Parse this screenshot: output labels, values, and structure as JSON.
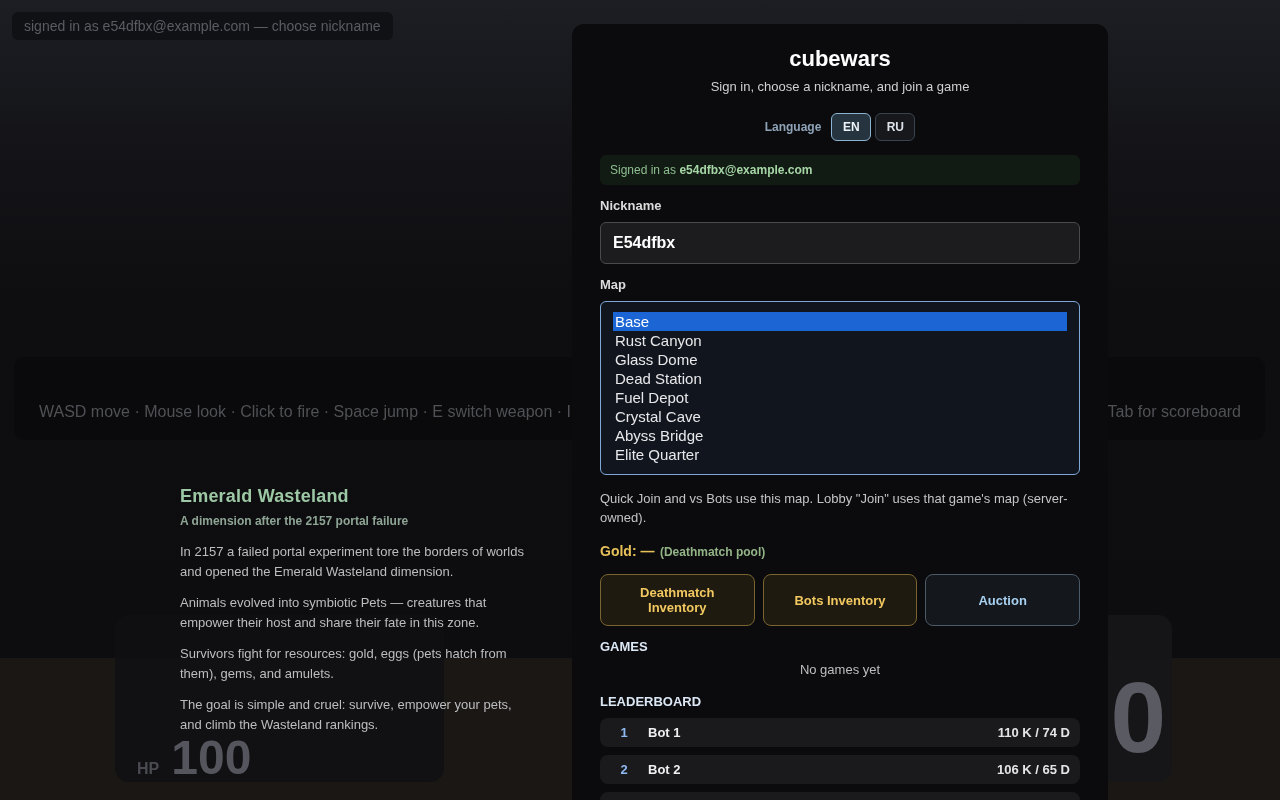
{
  "account_status": {
    "text": "signed in as e54dfbx@example.com — choose nickname"
  },
  "controls_hint": {
    "left_text": "WASD move · Mouse look · Click to fire · Space jump · E switch weapon · I",
    "right_text": "Tab for scoreboard"
  },
  "hud": {
    "hp": {
      "label": "HP",
      "value": "100"
    },
    "armor": {
      "value": "0"
    }
  },
  "lore": {
    "title": "Emerald Wasteland",
    "subtitle": "A dimension after the 2157 portal failure",
    "paragraphs": [
      "In 2157 a failed portal experiment tore the borders of worlds and opened the Emerald Wasteland dimension.",
      "Animals evolved into symbiotic Pets — creatures that empower their host and share their fate in this zone.",
      "Survivors fight for resources: gold, eggs (pets hatch from them), gems, and amulets.",
      "The goal is simple and cruel: survive, empower your pets, and climb the Wasteland rankings."
    ]
  },
  "dialog": {
    "title": "cubewars",
    "subtitle": "Sign in, choose a nickname, and join a game",
    "language": {
      "label": "Language",
      "options": [
        {
          "label": "EN",
          "selected": true
        },
        {
          "label": "RU",
          "selected": false
        }
      ]
    },
    "signed_in": "Signed in as **e54dfbx@example.com**",
    "nickname": {
      "label": "Nickname",
      "value": "E54dfbx"
    },
    "map": {
      "label": "Map",
      "options": [
        {
          "label": "Base",
          "selected": true
        },
        {
          "label": "Rust Canyon",
          "selected": false
        },
        {
          "label": "Glass Dome",
          "selected": false
        },
        {
          "label": "Dead Station",
          "selected": false
        },
        {
          "label": "Fuel Depot",
          "selected": false
        },
        {
          "label": "Crystal Cave",
          "selected": false
        },
        {
          "label": "Abyss Bridge",
          "selected": false
        },
        {
          "label": "Elite Quarter",
          "selected": false
        }
      ]
    },
    "map_hint": "Quick Join and vs Bots use this map. Lobby \"Join\" uses that game's map (server-owned).",
    "gold": {
      "label": "Gold: —",
      "note": "(Deathmatch pool)"
    },
    "buttons": [
      {
        "label": "Deathmatch Inventory",
        "kind": "inventory"
      },
      {
        "label": "Bots Inventory",
        "kind": "inventory"
      },
      {
        "label": "Auction",
        "kind": "market"
      }
    ],
    "games": {
      "heading": "GAMES",
      "empty_text": "No games yet"
    },
    "leaderboard": {
      "heading": "LEADERBOARD",
      "rows": [
        {
          "rank": "1",
          "name": "Bot 1",
          "score": "110 K / 74 D"
        },
        {
          "rank": "2",
          "name": "Bot 2",
          "score": "106 K / 65 D"
        }
      ]
    }
  }
}
